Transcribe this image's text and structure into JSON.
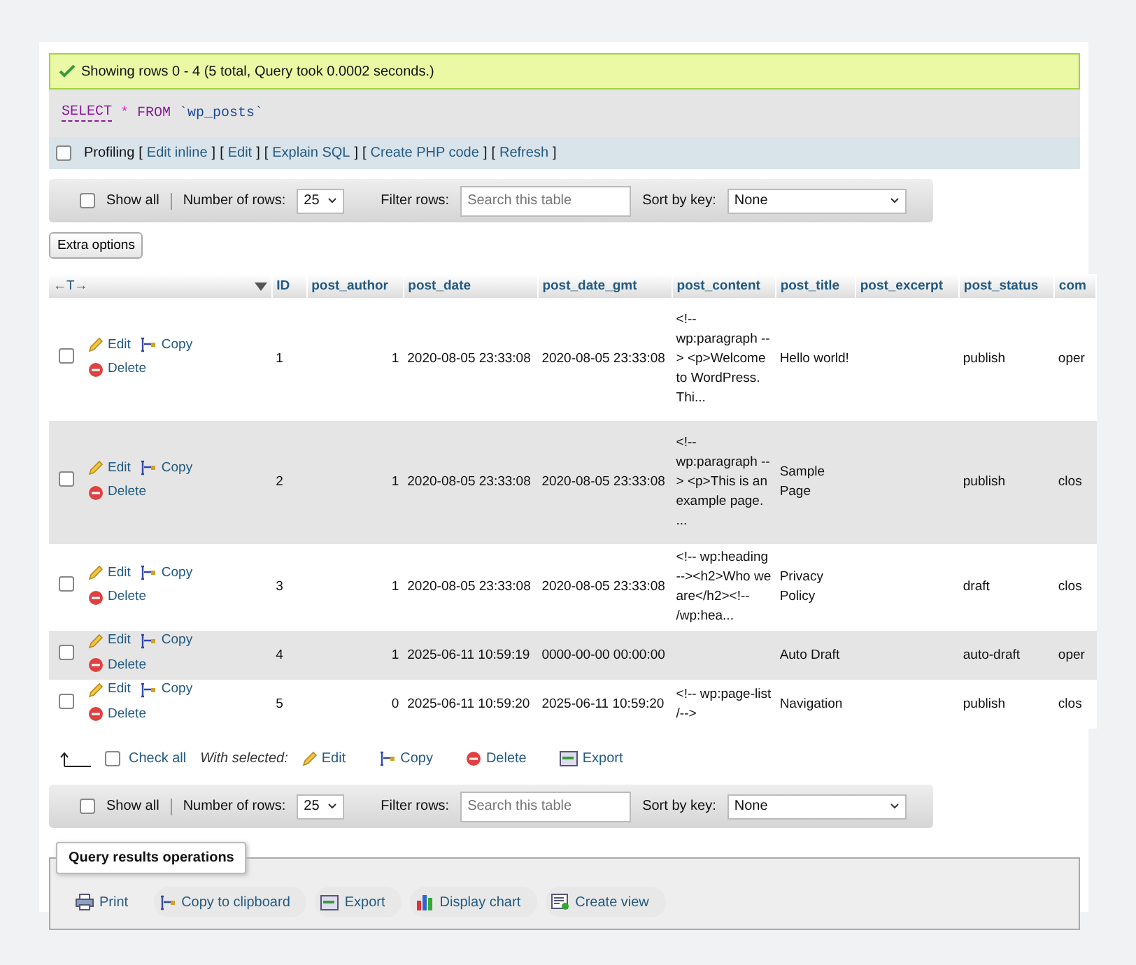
{
  "status": {
    "message": "Showing rows 0 - 4 (5 total, Query took 0.0002 seconds.)"
  },
  "query": {
    "keyword": "SELECT",
    "star": "*",
    "from": "FROM",
    "table": "`wp_posts`"
  },
  "profiling": {
    "label": "Profiling",
    "checked": false,
    "open": "[",
    "close": "]",
    "links": [
      "Edit inline",
      "Edit",
      "Explain SQL",
      "Create PHP code",
      "Refresh"
    ]
  },
  "navigation": [
    {
      "show_all": "Show all",
      "show_all_checked": false,
      "rows_label": "Number of rows:",
      "rows_value": "25",
      "filter_label": "Filter rows:",
      "filter_placeholder": "Search this table",
      "sort_label": "Sort by key:",
      "sort_value": "None"
    },
    {
      "show_all": "Show all",
      "show_all_checked": false,
      "rows_label": "Number of rows:",
      "rows_value": "25",
      "filter_label": "Filter rows:",
      "filter_placeholder": "Search this table",
      "sort_label": "Sort by key:",
      "sort_value": "None"
    }
  ],
  "extra_options": "Extra options",
  "table": {
    "column_toggle": "←T→",
    "columns": [
      "ID",
      "post_author",
      "post_date",
      "post_date_gmt",
      "post_content",
      "post_title",
      "post_excerpt",
      "post_status",
      "com"
    ],
    "rows": [
      {
        "selected": false,
        "actions": [
          {
            "kind": "edit",
            "label": "Edit"
          },
          {
            "kind": "copy",
            "label": "Copy"
          },
          {
            "kind": "delete",
            "label": "Delete"
          }
        ],
        "cells": [
          "1",
          "1",
          "2020-08-05 23:33:08",
          "2020-08-05 23:33:08",
          "<!-- wp:paragraph --> <p>Welcome to WordPress. Thi...",
          "Hello world!",
          "",
          "publish",
          "oper"
        ]
      },
      {
        "selected": false,
        "actions": [
          {
            "kind": "edit",
            "label": "Edit"
          },
          {
            "kind": "copy",
            "label": "Copy"
          },
          {
            "kind": "delete",
            "label": "Delete"
          }
        ],
        "cells": [
          "2",
          "1",
          "2020-08-05 23:33:08",
          "2020-08-05 23:33:08",
          "<!-- wp:paragraph --> <p>This is an example page. ...",
          "Sample Page",
          "",
          "publish",
          "clos"
        ]
      },
      {
        "selected": false,
        "actions": [
          {
            "kind": "edit",
            "label": "Edit"
          },
          {
            "kind": "copy",
            "label": "Copy"
          },
          {
            "kind": "delete",
            "label": "Delete"
          }
        ],
        "cells": [
          "3",
          "1",
          "2020-08-05 23:33:08",
          "2020-08-05 23:33:08",
          "<!-- wp:heading --><h2>Who we are</h2><!-- /wp:hea...",
          "Privacy Policy",
          "",
          "draft",
          "clos"
        ]
      },
      {
        "selected": false,
        "actions": [
          {
            "kind": "edit",
            "label": "Edit"
          },
          {
            "kind": "copy",
            "label": "Copy"
          },
          {
            "kind": "delete",
            "label": "Delete"
          }
        ],
        "cells": [
          "4",
          "1",
          "2025-06-11 10:59:19",
          "0000-00-00 00:00:00",
          "",
          "Auto Draft",
          "",
          "auto-draft",
          "oper"
        ]
      },
      {
        "selected": false,
        "actions": [
          {
            "kind": "edit",
            "label": "Edit"
          },
          {
            "kind": "copy",
            "label": "Copy"
          },
          {
            "kind": "delete",
            "label": "Delete"
          }
        ],
        "cells": [
          "5",
          "0",
          "2025-06-11 10:59:20",
          "2025-06-11 10:59:20",
          "<!-- wp:page-list /-->",
          "Navigation",
          "",
          "publish",
          "clos"
        ]
      }
    ]
  },
  "bulk": {
    "check_all": "Check all",
    "checked": false,
    "with_selected": "With selected:",
    "actions": [
      {
        "kind": "edit",
        "label": "Edit"
      },
      {
        "kind": "copy",
        "label": "Copy"
      },
      {
        "kind": "delete",
        "label": "Delete"
      },
      {
        "kind": "export",
        "label": "Export"
      }
    ]
  },
  "operations": {
    "title": "Query results operations",
    "buttons": [
      {
        "kind": "print",
        "label": "Print"
      },
      {
        "kind": "copy",
        "label": "Copy to clipboard"
      },
      {
        "kind": "export",
        "label": "Export"
      },
      {
        "kind": "chart",
        "label": "Display chart"
      },
      {
        "kind": "view",
        "label": "Create view"
      }
    ]
  }
}
